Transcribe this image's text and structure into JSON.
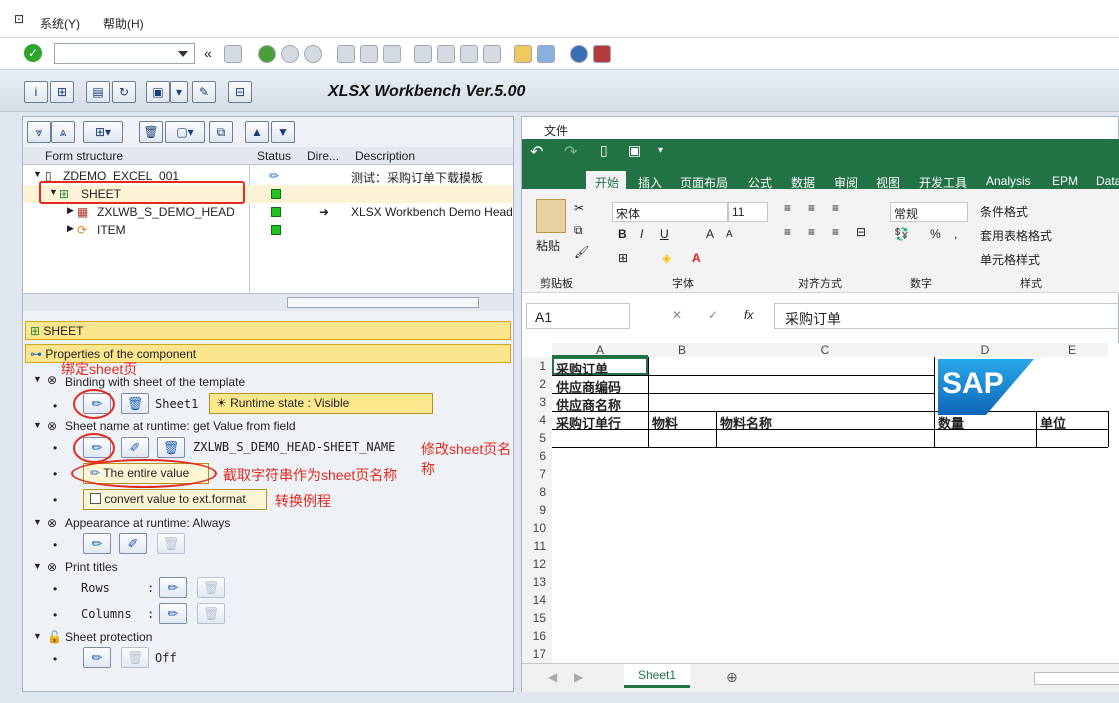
{
  "menu": {
    "system": "系统(Y)",
    "help": "帮助(H)"
  },
  "app": {
    "title": "XLSX Workbench Ver.5.00"
  },
  "tree": {
    "columns": [
      "Form structure",
      "Status",
      "Dire...",
      "Description"
    ],
    "rows": [
      {
        "label": "ZDEMO_EXCEL_001",
        "description": "测试：采购订单下载模板"
      },
      {
        "label": "SHEET",
        "description": ""
      },
      {
        "label": "ZXLWB_S_DEMO_HEAD",
        "description": "XLSX Workbench Demo Head"
      },
      {
        "label": "ITEM",
        "description": ""
      }
    ]
  },
  "props": {
    "sheet_label": "SHEET",
    "properties_label": "Properties of the component",
    "binding_label": "Binding with sheet of the template",
    "sheet_value": "Sheet1",
    "runtime_state": "Runtime state : Visible",
    "sheetname_label": "Sheet name at runtime: get Value from field",
    "sheetname_value": "ZXLWB_S_DEMO_HEAD-SHEET_NAME",
    "entire_value": "The entire value",
    "convert_label": "convert value to ext.format",
    "appearance_label": "Appearance at runtime: Always",
    "print_titles_label": "Print titles",
    "rows_label": "Rows",
    "columns_label": "Columns",
    "protection_label": "Sheet protection",
    "protection_value": "Off"
  },
  "annotations": {
    "bind_sheet": "绑定sheet页",
    "modify_name": "修改sheet页名称",
    "substring": "截取字符串作为sheet页名称",
    "convert": "转换例程"
  },
  "excel": {
    "file_tab": "文件",
    "tabs": [
      "开始",
      "插入",
      "页面布局",
      "公式",
      "数据",
      "审阅",
      "视图",
      "开发工具",
      "Analysis",
      "EPM",
      "Data"
    ],
    "font_name": "宋体",
    "font_size": "11",
    "number_format": "常规",
    "groups": [
      "剪贴板",
      "字体",
      "对齐方式",
      "数字",
      "样式"
    ],
    "style_items": [
      "条件格式",
      "套用表格格式",
      "单元格样式"
    ],
    "paste_label": "粘贴",
    "name_box": "A1",
    "formula": "采购订单",
    "columns": [
      "A",
      "B",
      "C",
      "D",
      "E"
    ],
    "row_numbers": [
      "1",
      "2",
      "3",
      "4",
      "5",
      "6",
      "7",
      "8",
      "9",
      "10",
      "11",
      "12",
      "13",
      "14",
      "15",
      "16",
      "17"
    ],
    "cells": {
      "a1": "采购订单",
      "a2": "供应商编码",
      "a3": "供应商名称",
      "a4": "采购订单行",
      "b4": "物料",
      "c4": "物料名称",
      "d4": "数量",
      "e4": "单位"
    },
    "logo_text": "SAP",
    "sheet_tab": "Sheet1"
  }
}
